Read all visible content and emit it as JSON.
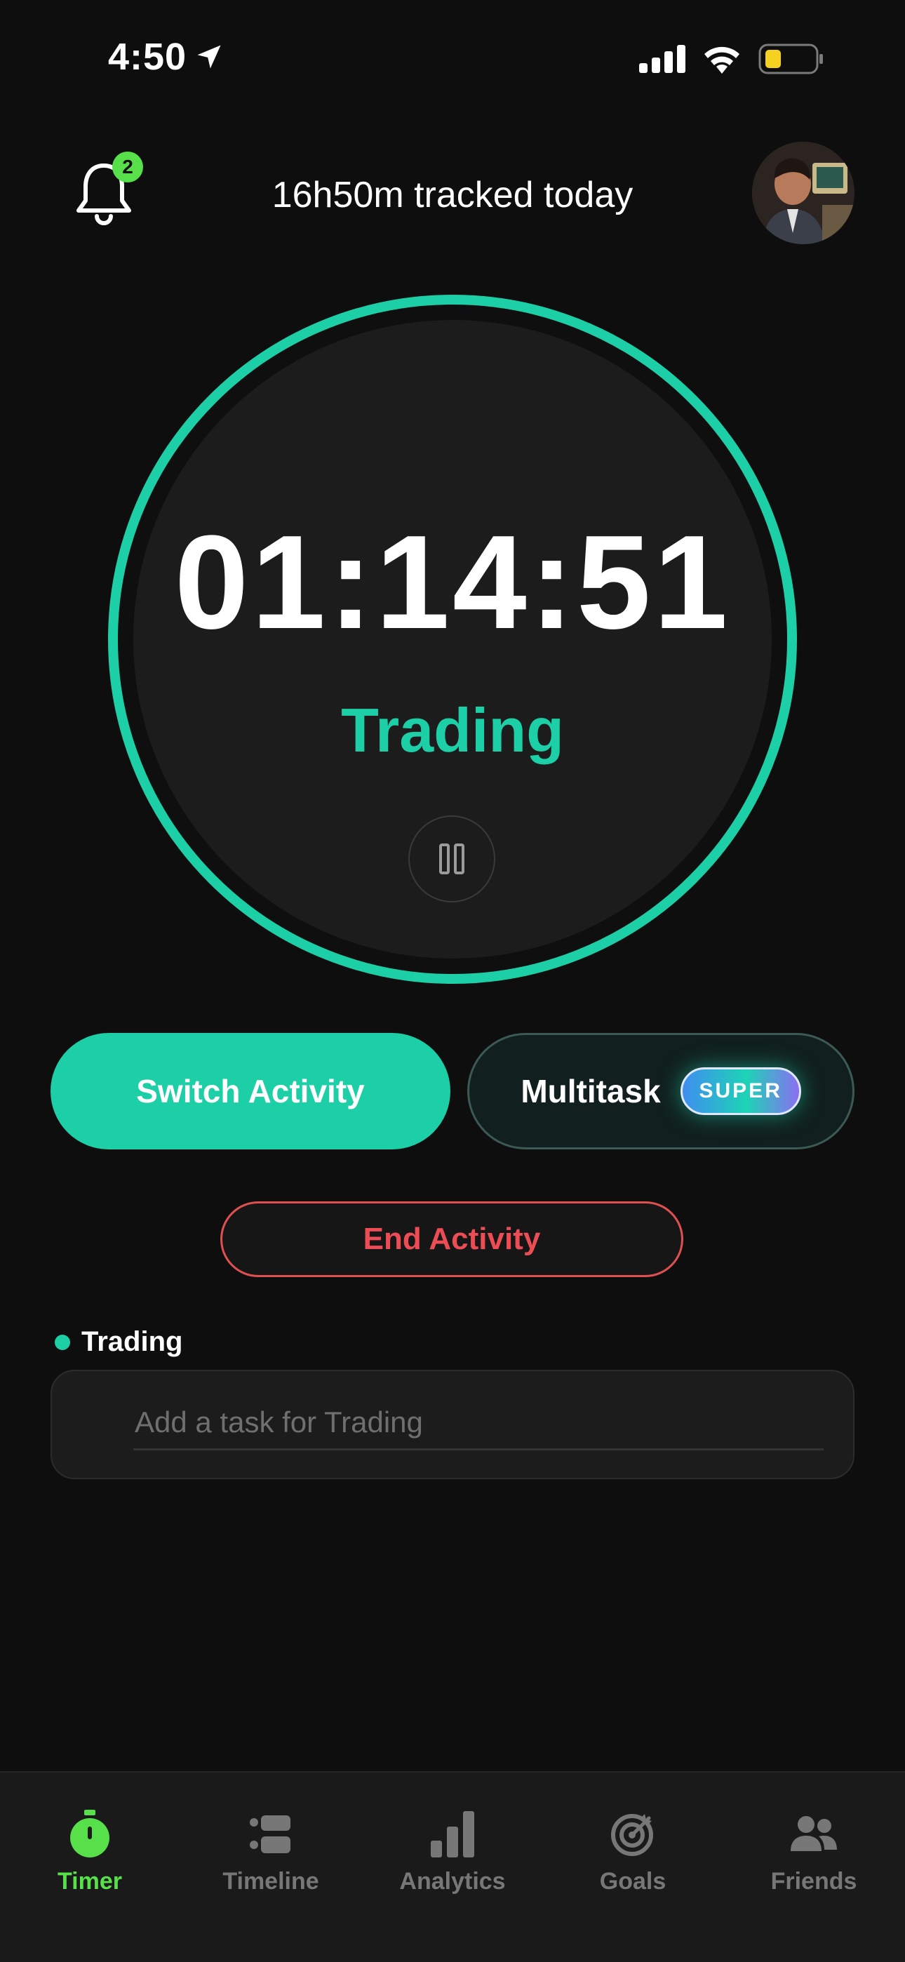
{
  "status_bar": {
    "time": "4:50"
  },
  "header": {
    "notification_count": "2",
    "tracked_text": "16h50m tracked today"
  },
  "timer": {
    "elapsed": "01:14:51",
    "activity": "Trading"
  },
  "actions": {
    "switch_label": "Switch Activity",
    "multitask_label": "Multitask",
    "super_badge": "SUPER",
    "end_label": "End Activity"
  },
  "tasks": {
    "section_label": "Trading",
    "placeholder": "Add a task for Trading"
  },
  "tabs": [
    {
      "label": "Timer",
      "icon": "stopwatch-icon",
      "active": true
    },
    {
      "label": "Timeline",
      "icon": "timeline-icon",
      "active": false
    },
    {
      "label": "Analytics",
      "icon": "bar-chart-icon",
      "active": false
    },
    {
      "label": "Goals",
      "icon": "target-icon",
      "active": false
    },
    {
      "label": "Friends",
      "icon": "people-icon",
      "active": false
    }
  ],
  "colors": {
    "accent": "#1dcfa6",
    "active_tab": "#58e04a",
    "danger": "#ec4d55",
    "background": "#0e0e0e"
  }
}
